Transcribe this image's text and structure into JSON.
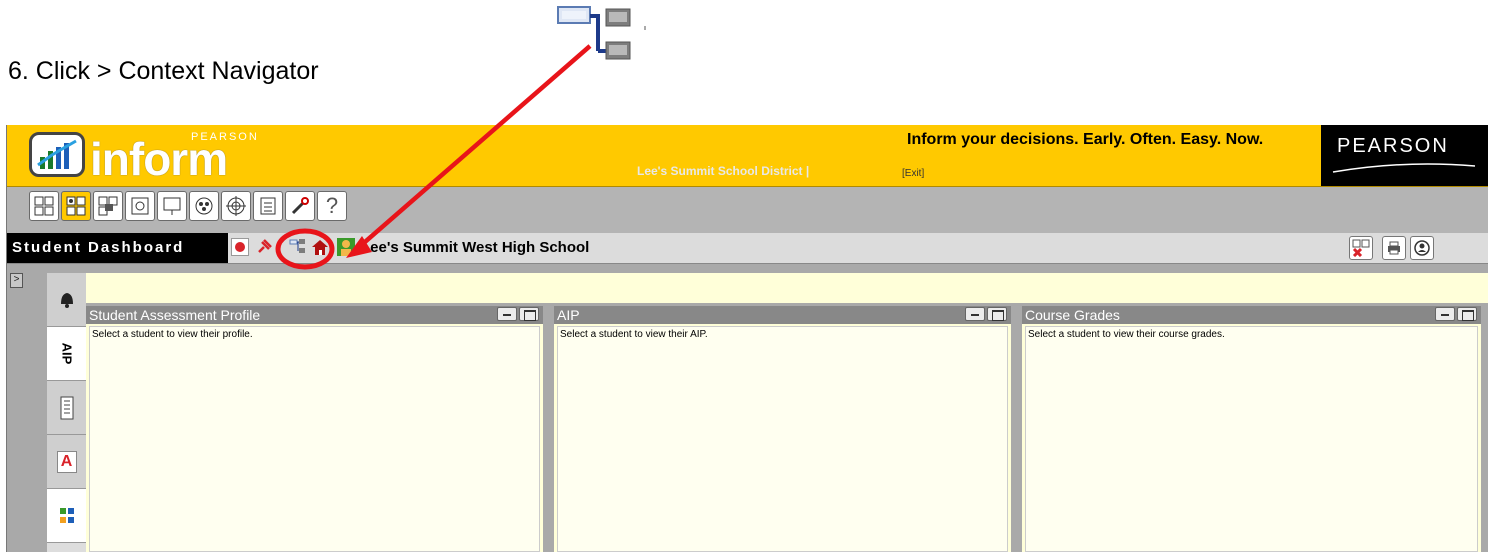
{
  "instruction": {
    "text": "6.  Click > Context Navigator"
  },
  "banner": {
    "logo_word": "inform",
    "logo_small": "PEARSON",
    "district": "Lee's Summit School District |",
    "exit_label": "[Exit]",
    "tagline": "Inform your decisions. Early. Often. Easy. Now.",
    "brand": "PEARSON"
  },
  "toolbar": {
    "buttons": [
      "home-grid-icon",
      "student-dashboard-icon",
      "lock-grid-icon",
      "report-icon",
      "presentation-icon",
      "group-icon",
      "target-icon",
      "checklist-icon",
      "tools-icon",
      "help-icon"
    ],
    "help_label": "?"
  },
  "dashbar": {
    "title": "Student Dashboard",
    "school": "Lee's Summit West High School"
  },
  "side_tabs": [
    {
      "icon": "bell-icon"
    },
    {
      "label": "AIP"
    },
    {
      "icon": "list-icon"
    },
    {
      "label": "A"
    },
    {
      "icon": "grid-icon"
    }
  ],
  "panels": [
    {
      "title": "Student Assessment Profile",
      "message": "Select a student to view their profile."
    },
    {
      "title": "AIP",
      "message": "Select a student to view their AIP."
    },
    {
      "title": "Course Grades",
      "message": "Select a student to view their course grades."
    }
  ],
  "colors": {
    "banner": "#ffc900",
    "annotation": "#e8141a",
    "panel_bg": "#ffffd9"
  }
}
